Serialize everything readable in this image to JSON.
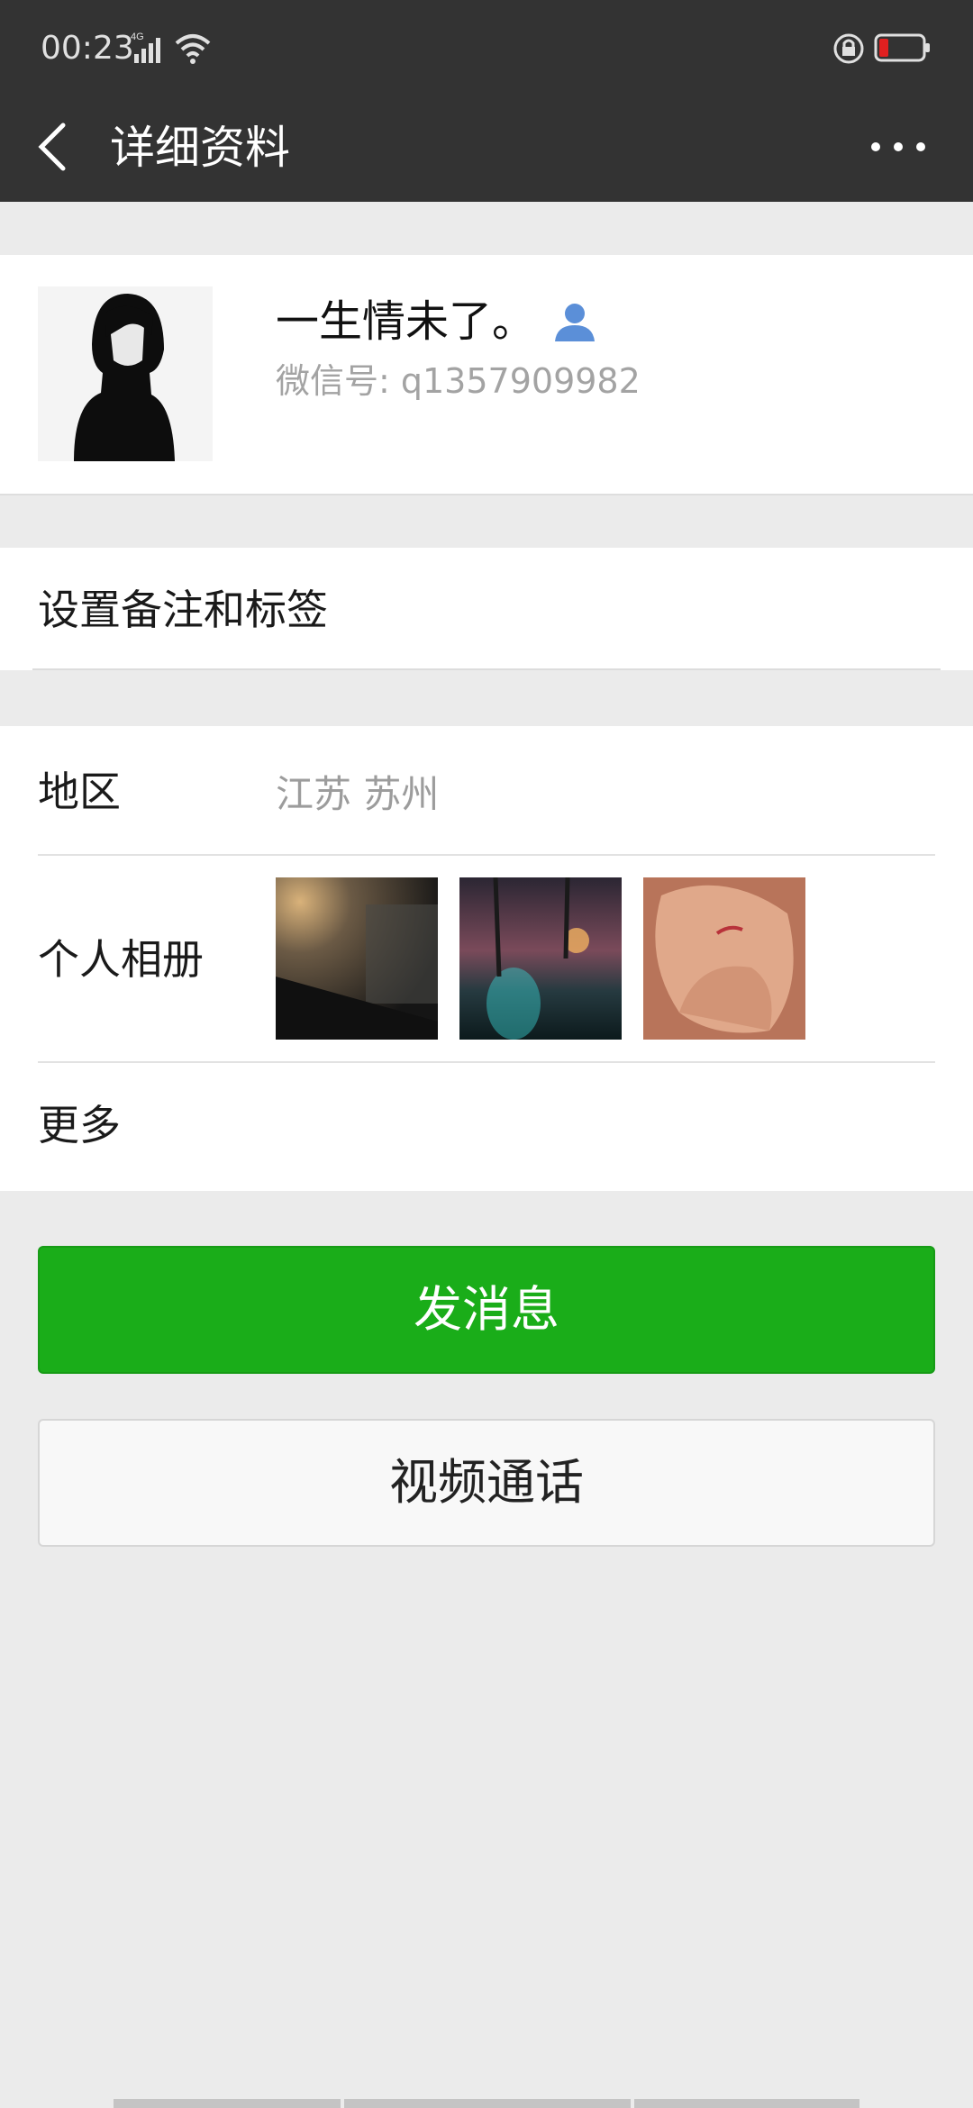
{
  "status_bar": {
    "time": "00:23",
    "network": "4G",
    "icons": [
      "signal-icon",
      "wifi-icon",
      "rotation-lock-icon",
      "battery-low-icon"
    ]
  },
  "title_bar": {
    "back_icon": "back-chevron-icon",
    "title": "详细资料",
    "more_icon": "more-dots-icon"
  },
  "profile": {
    "nickname": "一生情未了。",
    "wechat_id": "微信号: q1357909982",
    "contact_icon": "person-icon"
  },
  "remark": {
    "label": "设置备注和标签"
  },
  "info": {
    "region_label": "地区",
    "region_value": "江苏  苏州",
    "album_label": "个人相册",
    "album_photos": [
      "foggy-night-street-photo",
      "night-road-lights-photo",
      "injured-finger-photo"
    ],
    "more_label": "更多"
  },
  "actions": {
    "send_message": "发消息",
    "video_call": "视频通话"
  },
  "colors": {
    "bar": "#333333",
    "background": "#ebebeb",
    "accent_green": "#1aad19",
    "contact_icon": "#5b8fd8",
    "battery_low": "#e02020"
  }
}
